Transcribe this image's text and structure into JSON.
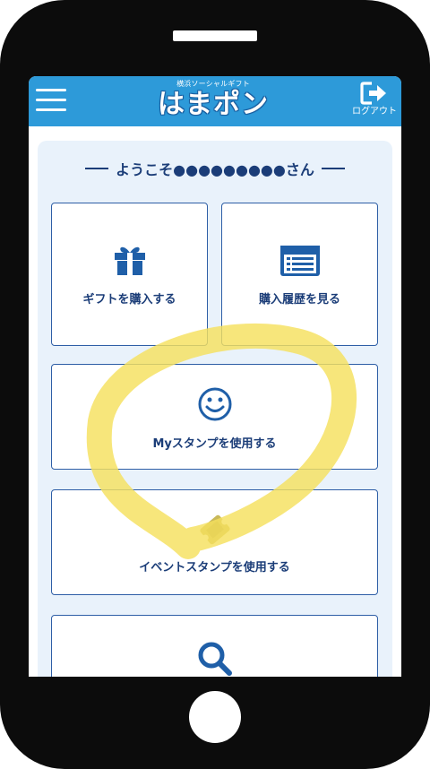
{
  "header": {
    "menu_icon": "hamburger-menu-icon",
    "brand_sub": "横浜ソーシャルギフト",
    "brand_logo": "はまポン",
    "logout_icon": "logout-door-arrow-icon",
    "logout_label": "ログアウト",
    "bar_color": "#2d9ad9"
  },
  "welcome": {
    "text": "ようこそ●●●●●●●●●さん"
  },
  "menu": {
    "buy_gift": {
      "label": "ギフトを購入する",
      "icon": "gift-icon"
    },
    "history": {
      "label": "購入履歴を見る",
      "icon": "list-document-icon"
    },
    "my_stamp": {
      "label": "Myスタンプを使用する",
      "icon": "smiley-icon"
    },
    "event_stamp": {
      "label": "イベントスタンプを使用する",
      "icon": "ticket-icon"
    },
    "search": {
      "icon": "search-icon"
    }
  },
  "colors": {
    "accent": "#2d9ad9",
    "text": "#1b3d78",
    "card_border": "#2e5ea6",
    "panel_bg": "#e9f2fb",
    "highlight": "#f7e36a"
  }
}
